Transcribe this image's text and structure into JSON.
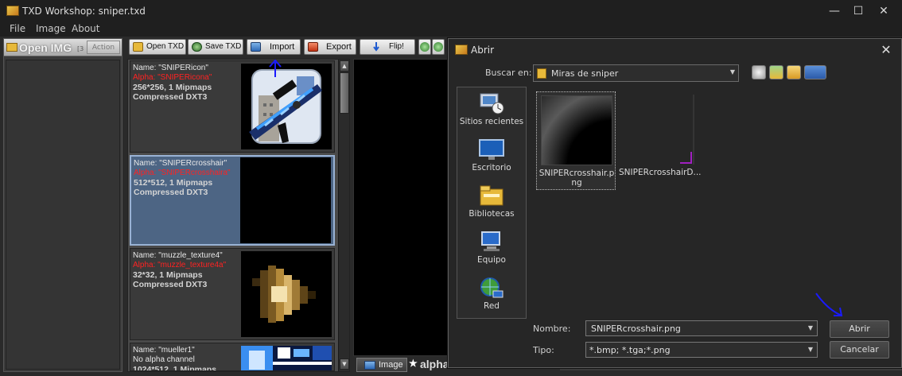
{
  "window": {
    "title": "TXD Workshop: sniper.txd",
    "minimize": "—",
    "maximize": "☐",
    "close": "✕"
  },
  "menu": [
    "File",
    "Image",
    "About"
  ],
  "left_panel": {
    "title": "Open IMG",
    "small": "[3",
    "action_label": "Action"
  },
  "toolbar": {
    "open_txd": "Open TXD",
    "save_txd": "Save TXD",
    "import": "Import",
    "export": "Export",
    "flip": "Flip!"
  },
  "textures": [
    {
      "name": "Name: \"SNIPERicon\"",
      "alpha": "Alpha: \"SNIPERicona\"",
      "dims": "256*256, 1 Mipmaps",
      "format": "Compressed DXT3"
    },
    {
      "name": "Name: \"SNIPERcrosshair\"",
      "alpha": "Alpha: \"SNIPERcrosshaira\"",
      "dims": "512*512, 1 Mipmaps",
      "format": "Compressed DXT3"
    },
    {
      "name": "Name: \"muzzle_texture4\"",
      "alpha": "Alpha: \"muzzle_texture4a\"",
      "dims": "32*32, 1 Mipmaps",
      "format": "Compressed DXT3"
    },
    {
      "name": "Name: \"mueller1\"",
      "alpha": "No alpha channel",
      "dims": "1024*512, 1 Mipmaps",
      "format": ""
    }
  ],
  "bottom_tabs": {
    "image": "Image",
    "alpha": "alpha"
  },
  "dialog": {
    "title": "Abrir",
    "close": "✕",
    "look_in_label": "Buscar en:",
    "look_in_value": "Miras de sniper",
    "places": [
      "Sitios recientes",
      "Escritorio",
      "Bibliotecas",
      "Equipo",
      "Red"
    ],
    "files": [
      "SNIPERcrosshair.png",
      "SNIPERcrosshairD..."
    ],
    "filename_label": "Nombre:",
    "filename_value": "SNIPERcrosshair.png",
    "type_label": "Tipo:",
    "type_value": "*.bmp; *.tga;*.png",
    "open_button": "Abrir",
    "cancel_button": "Cancelar"
  },
  "colors": {
    "selection": "#4d6584",
    "alpha_text": "#ff2222",
    "annotation": "#1a1aff"
  }
}
